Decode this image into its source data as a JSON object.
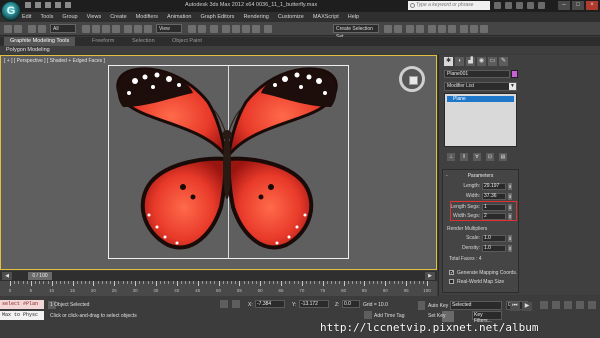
{
  "titlebar": {
    "logo": "3ds-max-logo",
    "title": "Autodesk 3ds Max 2012 x64      0036_11_1_butterfly.max",
    "search_placeholder": "Type a keyword or phrase"
  },
  "menu": [
    "Edit",
    "Tools",
    "Group",
    "Views",
    "Create",
    "Modifiers",
    "Animation",
    "Graph Editors",
    "Rendering",
    "Customize",
    "MAXScript",
    "Help"
  ],
  "toolbar": {
    "filter_select": "All",
    "view_select": "View",
    "selection_set": "Create Selection Set"
  },
  "ribbon": {
    "tabs": [
      "Graphite Modeling Tools",
      "Freeform",
      "Selection",
      "Object Paint"
    ],
    "panel_label": "Polygon Modeling"
  },
  "viewport": {
    "label": "[ + ] [ Perspective ] [ Shaded + Edged Faces ]"
  },
  "command_panel": {
    "object_name": "Plane001",
    "object_color": "#c860d6",
    "modifier_list": "Modifier List",
    "stack_item": "Plane",
    "rollout_title": "Parameters",
    "length_label": "Length:",
    "length_value": "29.197",
    "width_label": "Width:",
    "width_value": "37.36",
    "length_segs_label": "Length Segs:",
    "length_segs_value": "1",
    "width_segs_label": "Width Segs:",
    "width_segs_value": "2",
    "render_multipliers": "Render Multipliers",
    "scale_label": "Scale:",
    "scale_value": "1.0",
    "density_label": "Density:",
    "density_value": "1.0",
    "total_faces": "Total Faces : 4",
    "gen_mapping": "Generate Mapping Coords.",
    "real_world": "Real-World Map Size"
  },
  "timeline": {
    "position": "0 / 100",
    "ticks": [
      "0",
      "5",
      "10",
      "15",
      "20",
      "25",
      "30",
      "35",
      "40",
      "45",
      "50",
      "55",
      "60",
      "65",
      "70",
      "75",
      "80",
      "85",
      "90",
      "95",
      "100"
    ]
  },
  "status": {
    "maxscript_1": "select #Plan",
    "maxscript_2": "Max to Physc",
    "selected": "1 Object Selected",
    "prompt": "Click or click-and-drag to select objects",
    "x_label": "X:",
    "x_value": "-7.384",
    "y_label": "Y:",
    "y_value": "-13.172",
    "z_label": "Z:",
    "z_value": "0.0",
    "grid": "Grid = 10.0",
    "add_time_tag": "Add Time Tag",
    "autokey": "Auto Key",
    "selected_select": "Selected",
    "setkey": "Set Key",
    "key_filters": "Key Filters...",
    "frame": "0"
  },
  "overlay_url": "http://lccnetvip.pixnet.net/album"
}
